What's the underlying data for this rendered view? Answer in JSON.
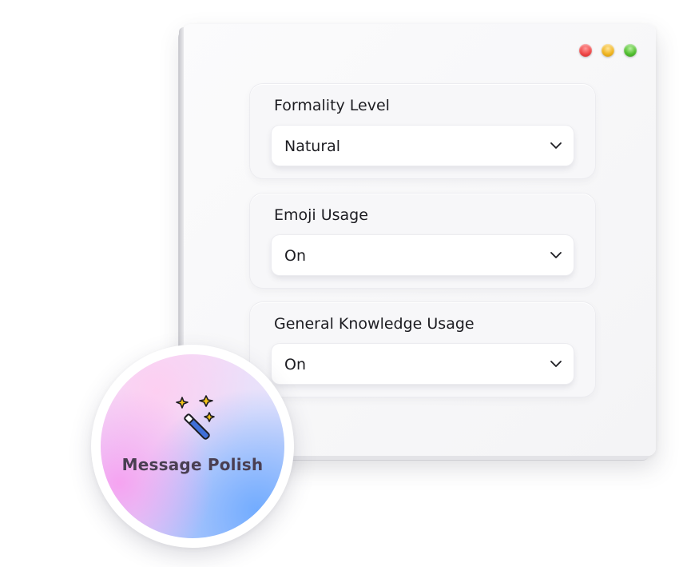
{
  "window": {
    "controls": [
      "close",
      "minimize",
      "maximize"
    ]
  },
  "settings": [
    {
      "label": "Formality Level",
      "value": "Natural"
    },
    {
      "label": "Emoji Usage",
      "value": "On"
    },
    {
      "label": "General Knowledge Usage",
      "value": "On"
    }
  ],
  "badge": {
    "title": "Message Polish",
    "icon": "magic-wand-icon"
  },
  "colors": {
    "close": "#f04848",
    "minimize": "#f0b520",
    "maximize": "#52c030",
    "wand": "#3f6fd8",
    "sparkle": "#f5c518"
  }
}
